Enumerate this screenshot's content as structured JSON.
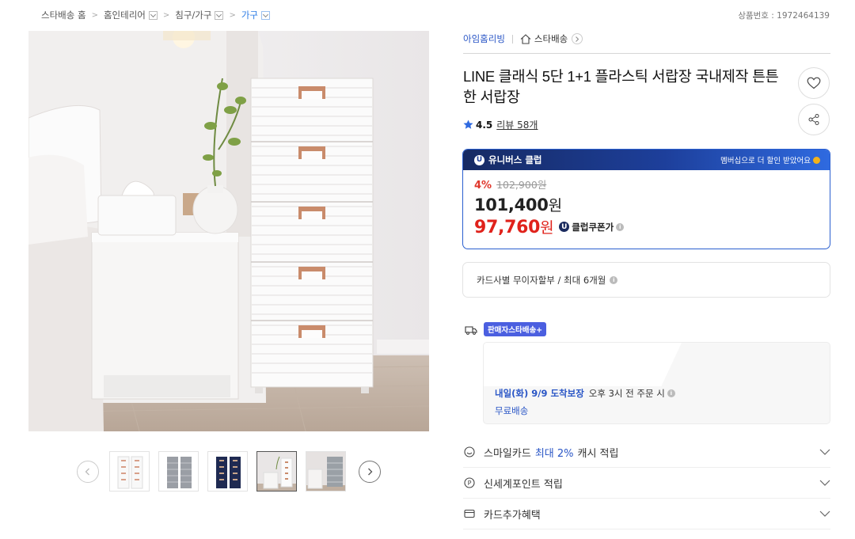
{
  "breadcrumb": {
    "items": [
      "스타배송 홈",
      "홈인테리어",
      "침구/가구",
      "가구"
    ]
  },
  "product_number": "상품번호 : 1972464139",
  "seller": {
    "name": "아임홈리빙",
    "star_delivery": "스타배송"
  },
  "product": {
    "title": "LINE 클래식 5단 1+1 플라스틱 서랍장 국내제작 튼튼한 서랍장",
    "rating": "4.5",
    "reviews": "리뷰 58개"
  },
  "club": {
    "name": "유니버스 클럽",
    "promo": "멤버십으로 더 할인 받았어요",
    "discount_pct": "4%",
    "original_price": "102,900원",
    "sale_price": "101,400",
    "club_price": "97,760",
    "won": "원",
    "club_coupon_label": "클럽쿠폰가"
  },
  "installment": "카드사별 무이자할부 / 최대 6개월",
  "delivery": {
    "tag": "판매자스타배송+",
    "arrival": "내일(화) 9/9 도착보장",
    "cutoff": "오후 3시 전 주문 시",
    "free": "무료배송"
  },
  "benefits": [
    {
      "label_pre": "스마일카드",
      "highlight": "최대 2%",
      "label_post": "캐시 적립"
    },
    {
      "label_pre": "신세계포인트 적립",
      "highlight": "",
      "label_post": ""
    },
    {
      "label_pre": "카드추가혜택",
      "highlight": "",
      "label_post": ""
    }
  ],
  "colors": {
    "accent_blue": "#2a56c6",
    "sale_red": "#e0221b",
    "club_border": "#2a5fd0",
    "club_head_dark": "#162a63"
  },
  "icons": {
    "truck": "truck-icon",
    "like": "heart-icon",
    "share": "share-icon"
  }
}
